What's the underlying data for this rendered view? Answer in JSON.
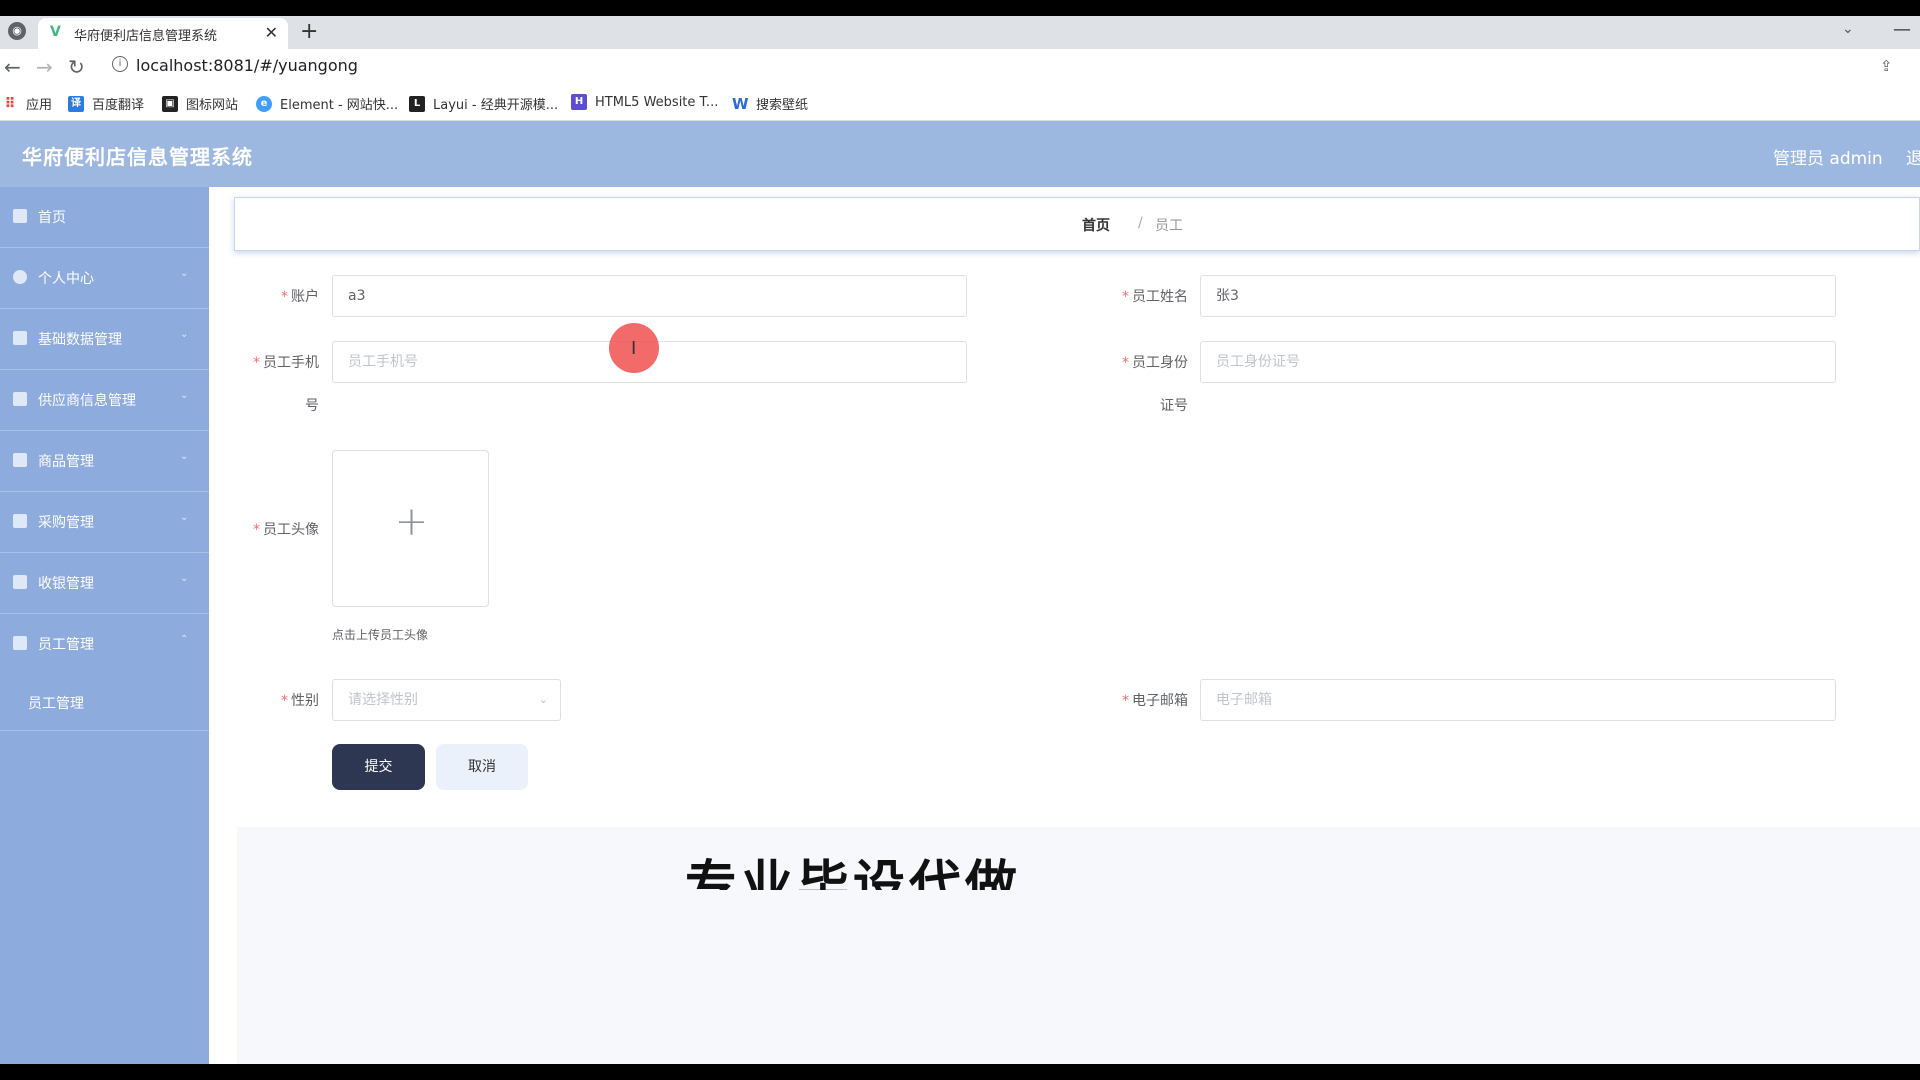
{
  "browser": {
    "tab_title": "华府便利店信息管理系统",
    "url": "localhost:8081/#/yuangong",
    "bookmarks": [
      {
        "label": "应用",
        "icon": "apps-grid-icon"
      },
      {
        "label": "百度翻译",
        "icon": "translate-icon"
      },
      {
        "label": "图标网站",
        "icon": "image-icon"
      },
      {
        "label": "Element - 网站快...",
        "icon": "element-icon"
      },
      {
        "label": "Layui - 经典开源模...",
        "icon": "layui-icon"
      },
      {
        "label": "HTML5 Website T...",
        "icon": "html5-icon"
      },
      {
        "label": "搜索壁纸",
        "icon": "wallpaper-icon"
      }
    ]
  },
  "header": {
    "app_title": "华府便利店信息管理系统",
    "admin_label": "管理员 admin",
    "logout_label": "退"
  },
  "sidebar": {
    "items": [
      {
        "label": "首页",
        "icon": "home-icon"
      },
      {
        "label": "个人中心",
        "icon": "user-icon"
      },
      {
        "label": "基础数据管理",
        "icon": "list-icon"
      },
      {
        "label": "供应商信息管理",
        "icon": "supplier-icon"
      },
      {
        "label": "商品管理",
        "icon": "goods-icon"
      },
      {
        "label": "采购管理",
        "icon": "purchase-icon"
      },
      {
        "label": "收银管理",
        "icon": "cashier-icon"
      },
      {
        "label": "员工管理",
        "icon": "staff-icon"
      }
    ],
    "sub_item": "员工管理"
  },
  "breadcrumb": {
    "home": "首页",
    "separator": "/",
    "current": "员工"
  },
  "form": {
    "account": {
      "label": "账户",
      "value": "a3"
    },
    "name": {
      "label": "员工姓名",
      "value": "张3"
    },
    "phone": {
      "label_line1": "员工手机",
      "label_line2": "号",
      "placeholder": "员工手机号"
    },
    "idcard": {
      "label_line1": "员工身份",
      "label_line2": "证号",
      "placeholder": "员工身份证号"
    },
    "avatar": {
      "label": "员工头像",
      "tip": "点击上传员工头像"
    },
    "gender": {
      "label": "性别",
      "placeholder": "请选择性别"
    },
    "email": {
      "label": "电子邮箱",
      "placeholder": "电子邮箱"
    },
    "submit_label": "提交",
    "cancel_label": "取消"
  },
  "overlay_text": "专业毕设代做",
  "colors": {
    "header_bg": "#9db8e0",
    "sidebar_bg": "#8eabdd",
    "submit_bg": "#2e3752",
    "required": "#f56c6c"
  }
}
